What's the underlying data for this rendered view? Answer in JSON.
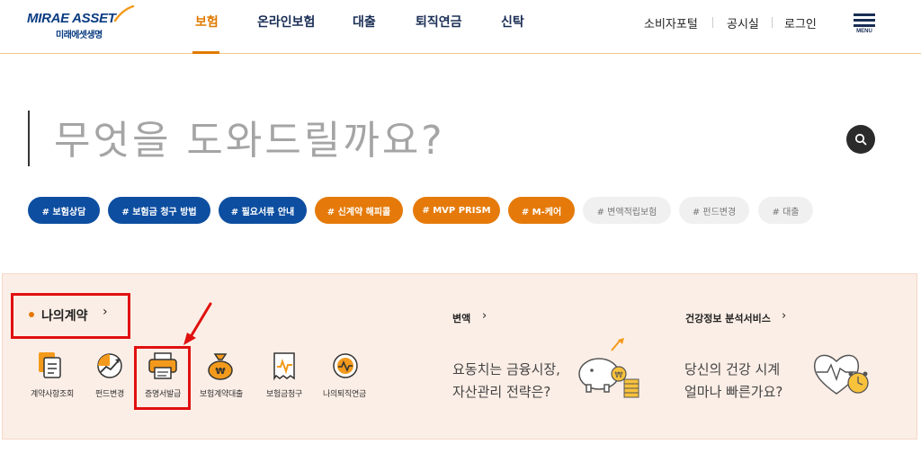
{
  "header": {
    "logo_main": "MIRAE ASSET",
    "logo_sub": "미래에셋생명",
    "nav": [
      "보험",
      "온라인보험",
      "대출",
      "퇴직연금",
      "신탁"
    ],
    "active_nav": "보험",
    "util": [
      "소비자포털",
      "공시실",
      "로그인"
    ],
    "menu_label": "MENU"
  },
  "search": {
    "prompt": "무엇을 도와드릴까요?"
  },
  "tags": [
    {
      "label": "# 보험상담",
      "style": "blue"
    },
    {
      "label": "# 보험금 청구 방법",
      "style": "blue"
    },
    {
      "label": "# 필요서류 안내",
      "style": "blue"
    },
    {
      "label": "# 신계약 해피콜",
      "style": "orange"
    },
    {
      "label": "# MVP PRISM",
      "style": "orange"
    },
    {
      "label": "# M-케어",
      "style": "orange"
    },
    {
      "label": "# 변액적립보험",
      "style": "gray"
    },
    {
      "label": "# 펀드변경",
      "style": "gray"
    },
    {
      "label": "# 대출",
      "style": "gray"
    }
  ],
  "my_contract": {
    "title": "나의계약",
    "arrow": "›",
    "items": [
      {
        "label": "계약사항조회",
        "icon": "document-icon"
      },
      {
        "label": "펀드변경",
        "icon": "fund-chart-icon"
      },
      {
        "label": "증명서발급",
        "icon": "printer-icon"
      },
      {
        "label": "보험계약대출",
        "icon": "money-bag-icon"
      },
      {
        "label": "보험금청구",
        "icon": "claim-receipt-icon"
      },
      {
        "label": "나의퇴직연금",
        "icon": "pension-icon"
      }
    ]
  },
  "variable": {
    "title": "변액",
    "arrow": "›",
    "line1": "요동치는 금융시장,",
    "line2": "자산관리 전략은?"
  },
  "health": {
    "title": "건강정보 분석서비스",
    "arrow": "›",
    "line1": "당신의 건강 시계",
    "line2": "얼마나 빠른가요?"
  },
  "colors": {
    "brand_blue": "#0d4ea0",
    "brand_orange": "#e57a0a",
    "highlight_red": "#e01010",
    "panel_bg": "#fbeee6"
  }
}
